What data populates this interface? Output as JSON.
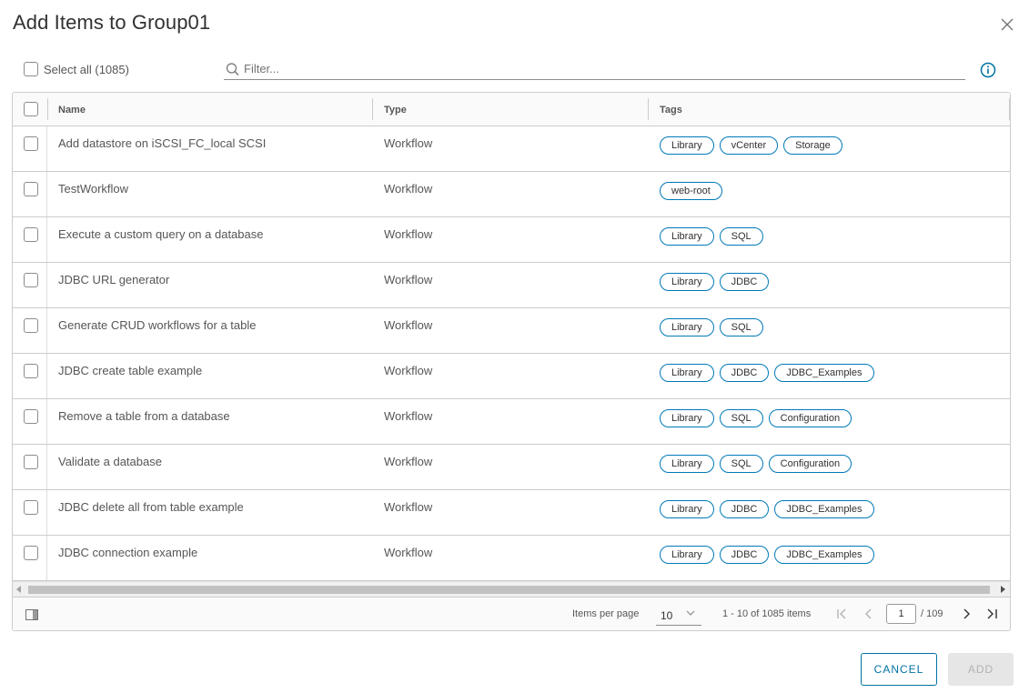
{
  "dialog": {
    "title": "Add Items to Group01",
    "select_all_label": "Select all (1085)",
    "filter_placeholder": "Filter..."
  },
  "grid": {
    "columns": [
      "Name",
      "Type",
      "Tags"
    ],
    "rows": [
      {
        "name": "Add datastore on iSCSI_FC_local SCSI",
        "type": "Workflow",
        "tags": [
          "Library",
          "vCenter",
          "Storage"
        ]
      },
      {
        "name": "TestWorkflow",
        "type": "Workflow",
        "tags": [
          "web-root"
        ]
      },
      {
        "name": "Execute a custom query on a database",
        "type": "Workflow",
        "tags": [
          "Library",
          "SQL"
        ]
      },
      {
        "name": "JDBC URL generator",
        "type": "Workflow",
        "tags": [
          "Library",
          "JDBC"
        ]
      },
      {
        "name": "Generate CRUD workflows for a table",
        "type": "Workflow",
        "tags": [
          "Library",
          "SQL"
        ]
      },
      {
        "name": "JDBC create table example",
        "type": "Workflow",
        "tags": [
          "Library",
          "JDBC",
          "JDBC_Examples"
        ]
      },
      {
        "name": "Remove a table from a database",
        "type": "Workflow",
        "tags": [
          "Library",
          "SQL",
          "Configuration"
        ]
      },
      {
        "name": "Validate a database",
        "type": "Workflow",
        "tags": [
          "Library",
          "SQL",
          "Configuration"
        ]
      },
      {
        "name": "JDBC delete all from table example",
        "type": "Workflow",
        "tags": [
          "Library",
          "JDBC",
          "JDBC_Examples"
        ]
      },
      {
        "name": "JDBC connection example",
        "type": "Workflow",
        "tags": [
          "Library",
          "JDBC",
          "JDBC_Examples"
        ]
      }
    ]
  },
  "pagination": {
    "items_per_page_label": "Items per page",
    "items_per_page_value": "10",
    "range_text": "1 - 10 of 1085 items",
    "current_page": "1",
    "total_pages_text": "/ 109"
  },
  "buttons": {
    "cancel": "CANCEL",
    "add": "ADD"
  },
  "colors": {
    "accent": "#0072a3",
    "tag_border": "#0079b8",
    "disabled_bg": "#e6e6e6"
  },
  "icons": [
    "close-icon",
    "search-icon",
    "info-icon",
    "column-toggle-icon",
    "chevron-down-icon",
    "first-page-icon",
    "prev-page-icon",
    "next-page-icon",
    "last-page-icon"
  ]
}
